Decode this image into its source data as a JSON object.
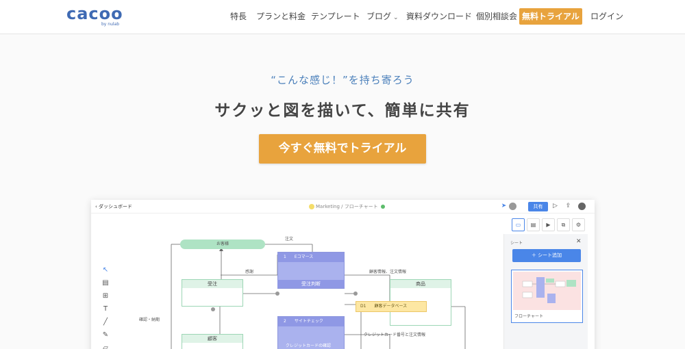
{
  "header": {
    "logo": "cacoo",
    "logo_sub": "by nulab",
    "nav": [
      "特長",
      "プランと料金",
      "テンプレート",
      "ブログ",
      "資料ダウンロード",
      "個別相談会"
    ],
    "cta": "無料トライアル",
    "login": "ログイン"
  },
  "hero": {
    "subtitle": "“こんな感じ！”を持ち寄ろう",
    "title": "サクッと図を描いて、簡単に共有",
    "cta": "今すぐ無料でトライアル"
  },
  "app": {
    "back": "‹ ダッシュボード",
    "doc_title": "Marketing / フローチャート",
    "share": "共有",
    "panel": {
      "sheet_label": "シート",
      "close": "✕",
      "add_sheet": "＋ シート追加",
      "thumb_label": "フローチャート"
    },
    "canvas": {
      "customer_pill": "お客様",
      "order_label": "注文",
      "cart_label": "感謝",
      "confirm_label": "確認・納期",
      "info_label": "顧客情報、注文情報",
      "ecommerce": "1　　Eコマース",
      "order_recv": "受注判断",
      "order_box": "受注",
      "product_box": "商品",
      "customer_box": "顧客",
      "site_check": "2　　サイトチェック",
      "db_label": "D1　　顧客データベース",
      "card_label": "クレジットカード番号と注文情報",
      "card_confirm": "クレジットカードの確認"
    },
    "colors": {
      "accent": "#e8a33d",
      "blue": "#4a86e8",
      "purple": "#aab2ee",
      "green": "#aee3c4"
    }
  },
  "colors": {
    "cta": "#e8a33d",
    "logo": "#3f6ab3",
    "subtitle": "#4a7fba"
  }
}
